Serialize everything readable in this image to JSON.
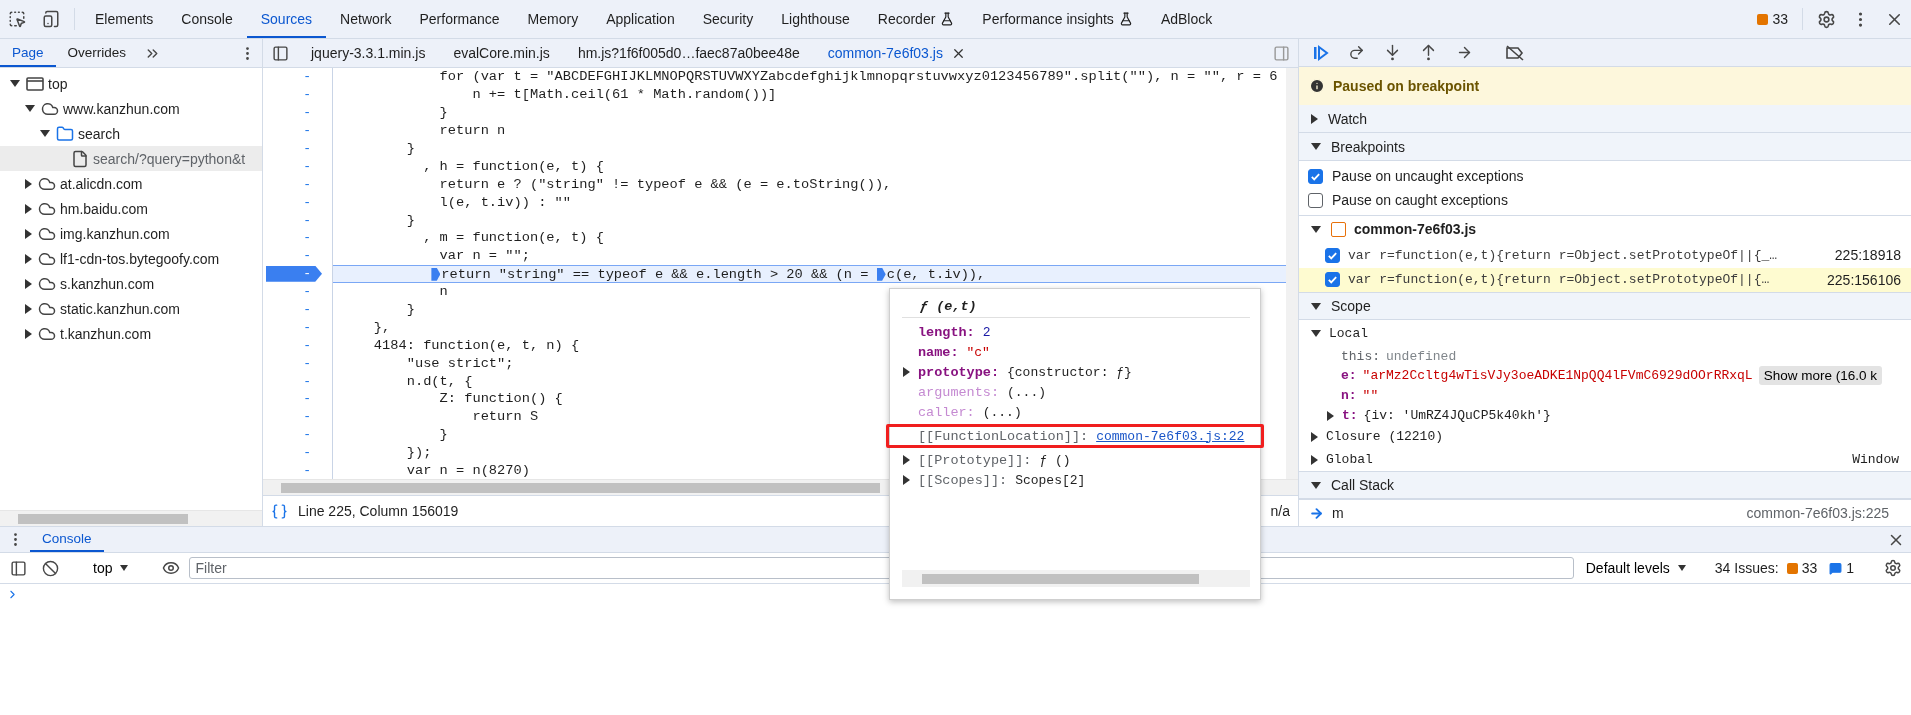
{
  "main_tabs": [
    {
      "label": "Elements",
      "selected": false,
      "experimental": false
    },
    {
      "label": "Console",
      "selected": false,
      "experimental": false
    },
    {
      "label": "Sources",
      "selected": true,
      "experimental": false
    },
    {
      "label": "Network",
      "selected": false,
      "experimental": false
    },
    {
      "label": "Performance",
      "selected": false,
      "experimental": false
    },
    {
      "label": "Memory",
      "selected": false,
      "experimental": false
    },
    {
      "label": "Application",
      "selected": false,
      "experimental": false
    },
    {
      "label": "Security",
      "selected": false,
      "experimental": false
    },
    {
      "label": "Lighthouse",
      "selected": false,
      "experimental": false
    },
    {
      "label": "Recorder",
      "selected": false,
      "experimental": true
    },
    {
      "label": "Performance insights",
      "selected": false,
      "experimental": true
    },
    {
      "label": "AdBlock",
      "selected": false,
      "experimental": false
    }
  ],
  "issues_badge": "33",
  "navigator": {
    "tabs": [
      {
        "label": "Page",
        "selected": true
      },
      {
        "label": "Overrides",
        "selected": false
      }
    ],
    "tree": [
      {
        "kind": "frame",
        "label": "top",
        "expanded": true,
        "selected": false,
        "children": [
          {
            "kind": "domain",
            "label": "www.kanzhun.com",
            "expanded": true,
            "selected": false,
            "children": [
              {
                "kind": "folder",
                "label": "search",
                "expanded": true,
                "selected": false,
                "children": [
                  {
                    "kind": "file",
                    "label": "search/?query=python&t",
                    "selected": true
                  }
                ]
              }
            ]
          },
          {
            "kind": "domain",
            "label": "at.alicdn.com",
            "expanded": false,
            "selected": false
          },
          {
            "kind": "domain",
            "label": "hm.baidu.com",
            "expanded": false,
            "selected": false
          },
          {
            "kind": "domain",
            "label": "img.kanzhun.com",
            "expanded": false,
            "selected": false
          },
          {
            "kind": "domain",
            "label": "lf1-cdn-tos.bytegoofy.com",
            "expanded": false,
            "selected": false
          },
          {
            "kind": "domain",
            "label": "s.kanzhun.com",
            "expanded": false,
            "selected": false
          },
          {
            "kind": "domain",
            "label": "static.kanzhun.com",
            "expanded": false,
            "selected": false
          },
          {
            "kind": "domain",
            "label": "t.kanzhun.com",
            "expanded": false,
            "selected": false
          }
        ]
      }
    ]
  },
  "editor": {
    "file_tabs": [
      {
        "label": "jquery-3.3.1.min.js",
        "selected": false
      },
      {
        "label": "evalCore.min.js",
        "selected": false
      },
      {
        "label": "hm.js?1f6f005d0…faec87a0bee48e",
        "selected": false
      },
      {
        "label": "common-7e6f03.js",
        "selected": true
      }
    ],
    "lines": [
      {
        "kind": "code",
        "number": "-",
        "text": "            for (var t = \"ABCDEFGHIJKLMNOPQRSTUVWXYZabcdefghijklmnopqrstuvwxyz0123456789\".split(\"\"), n = \"\", r = 6"
      },
      {
        "kind": "code",
        "number": "-",
        "text": "                n += t[Math.ceil(61 * Math.random())]"
      },
      {
        "kind": "code",
        "number": "-",
        "text": "            }"
      },
      {
        "kind": "code",
        "number": "-",
        "text": "            return n"
      },
      {
        "kind": "code",
        "number": "-",
        "text": "        }"
      },
      {
        "kind": "code",
        "number": "-",
        "text": "          , h = function(e, t) {"
      },
      {
        "kind": "code",
        "number": "-",
        "text": "            return e ? (\"string\" != typeof e && (e = e.toString()),"
      },
      {
        "kind": "code",
        "number": "-",
        "text": "            l(e, t.iv)) : \"\""
      },
      {
        "kind": "code",
        "number": "-",
        "text": "        }"
      },
      {
        "kind": "code",
        "number": "-",
        "text": "          , m = function(e, t) {"
      },
      {
        "kind": "code",
        "number": "-",
        "text": "            var n = \"\";"
      },
      {
        "kind": "paused",
        "number": "-",
        "segments": [
          "            return \"string\" == typeof e && e.length > 20 && (n = ",
          "c(e, t.iv)),"
        ]
      },
      {
        "kind": "code",
        "number": "-",
        "text": "            n"
      },
      {
        "kind": "code",
        "number": "-",
        "text": "        }"
      },
      {
        "kind": "code",
        "number": "-",
        "text": "    },"
      },
      {
        "kind": "code",
        "number": "-",
        "text": "    4184: function(e, t, n) {"
      },
      {
        "kind": "code",
        "number": "-",
        "text": "        \"use strict\";"
      },
      {
        "kind": "code",
        "number": "-",
        "text": "        n.d(t, {"
      },
      {
        "kind": "code",
        "number": "-",
        "text": "            Z: function() {"
      },
      {
        "kind": "code",
        "number": "-",
        "text": "                return S"
      },
      {
        "kind": "code",
        "number": "-",
        "text": "            }"
      },
      {
        "kind": "code",
        "number": "-",
        "text": "        });"
      },
      {
        "kind": "code",
        "number": "-",
        "text": "        var n = n(8270)"
      }
    ],
    "status": "Line 225, Column 156019",
    "status_right": "n/a"
  },
  "popup": {
    "header": "ƒ (e,t)",
    "props": [
      {
        "kind": "own",
        "key": "length:",
        "value": {
          "kind": "number",
          "text": "2"
        },
        "expandable": false
      },
      {
        "kind": "own",
        "key": "name:",
        "value": {
          "kind": "string",
          "text": "\"c\""
        },
        "expandable": false
      },
      {
        "kind": "own",
        "key": "prototype:",
        "value": {
          "kind": "plain",
          "text": "{constructor: ƒ}"
        },
        "expandable": true
      },
      {
        "kind": "dim",
        "key": "arguments:",
        "value": {
          "kind": "plain",
          "text": "(...)"
        },
        "expandable": false
      },
      {
        "kind": "dim",
        "key": "caller:",
        "value": {
          "kind": "plain",
          "text": "(...)"
        },
        "expandable": false
      },
      {
        "kind": "internal",
        "key": "[[FunctionLocation]]:",
        "value": {
          "kind": "link",
          "text": "common-7e6f03.js:22"
        },
        "expandable": false,
        "annotated": true
      },
      {
        "kind": "internal",
        "key": "[[Prototype]]:",
        "value": {
          "kind": "plain",
          "text": "ƒ ()"
        },
        "expandable": true
      },
      {
        "kind": "internal",
        "key": "[[Scopes]]:",
        "value": {
          "kind": "plain",
          "text": "Scopes[2]"
        },
        "expandable": true
      }
    ]
  },
  "debugger": {
    "banner": "Paused on breakpoint",
    "watch": {
      "label": "Watch",
      "expanded": false
    },
    "breakpoints": {
      "label": "Breakpoints",
      "expanded": true,
      "options": [
        {
          "label": "Pause on uncaught exceptions",
          "checked": true
        },
        {
          "label": "Pause on caught exceptions",
          "checked": false
        }
      ],
      "file": {
        "name": "common-7e6f03.js",
        "expanded": true
      },
      "items": [
        {
          "code": "var r=function(e,t){return r=Object.setPrototypeOf||{_…",
          "location": "225:18918",
          "checked": true,
          "selected": false
        },
        {
          "code": "var r=function(e,t){return r=Object.setPrototypeOf||{…",
          "location": "225:156106",
          "checked": true,
          "selected": true
        }
      ]
    },
    "scope": {
      "label": "Scope",
      "expanded": true,
      "local": {
        "label": "Local",
        "expanded": true,
        "vars": [
          {
            "kind": "plain",
            "name": "this:",
            "value": {
              "kind": "undefined",
              "text": "undefined"
            },
            "expandable": false
          },
          {
            "kind": "own",
            "name": "e:",
            "value": {
              "kind": "string",
              "text": "\"arMz2Ccltg4wTisVJy3oeADKE1NpQQ4lFVmC6929dOOrRRxqL"
            },
            "expandable": false,
            "show_more": "Show more (16.0 k"
          },
          {
            "kind": "own",
            "name": "n:",
            "value": {
              "kind": "string",
              "text": "\"\""
            },
            "expandable": false
          },
          {
            "kind": "own",
            "name": "t:",
            "value": {
              "kind": "plain",
              "text": "{iv: 'UmRZ4JQuCP5k40kh'}"
            },
            "expandable": true
          }
        ]
      },
      "groups": [
        {
          "label": "Closure (12210)",
          "expanded": false
        },
        {
          "label": "Global",
          "expanded": false,
          "value": "Window"
        }
      ]
    },
    "call_stack": {
      "label": "Call Stack",
      "expanded": true,
      "frames": [
        {
          "name": "m",
          "location": "common-7e6f03.js:225",
          "selected": true
        }
      ]
    }
  },
  "drawer": {
    "tabs": [
      {
        "label": "Console",
        "selected": true
      }
    ],
    "context": "top",
    "filter_placeholder": "Filter",
    "levels": "Default levels",
    "issues_label": "34 Issues:",
    "warning_count": "33",
    "info_count": "1"
  }
}
